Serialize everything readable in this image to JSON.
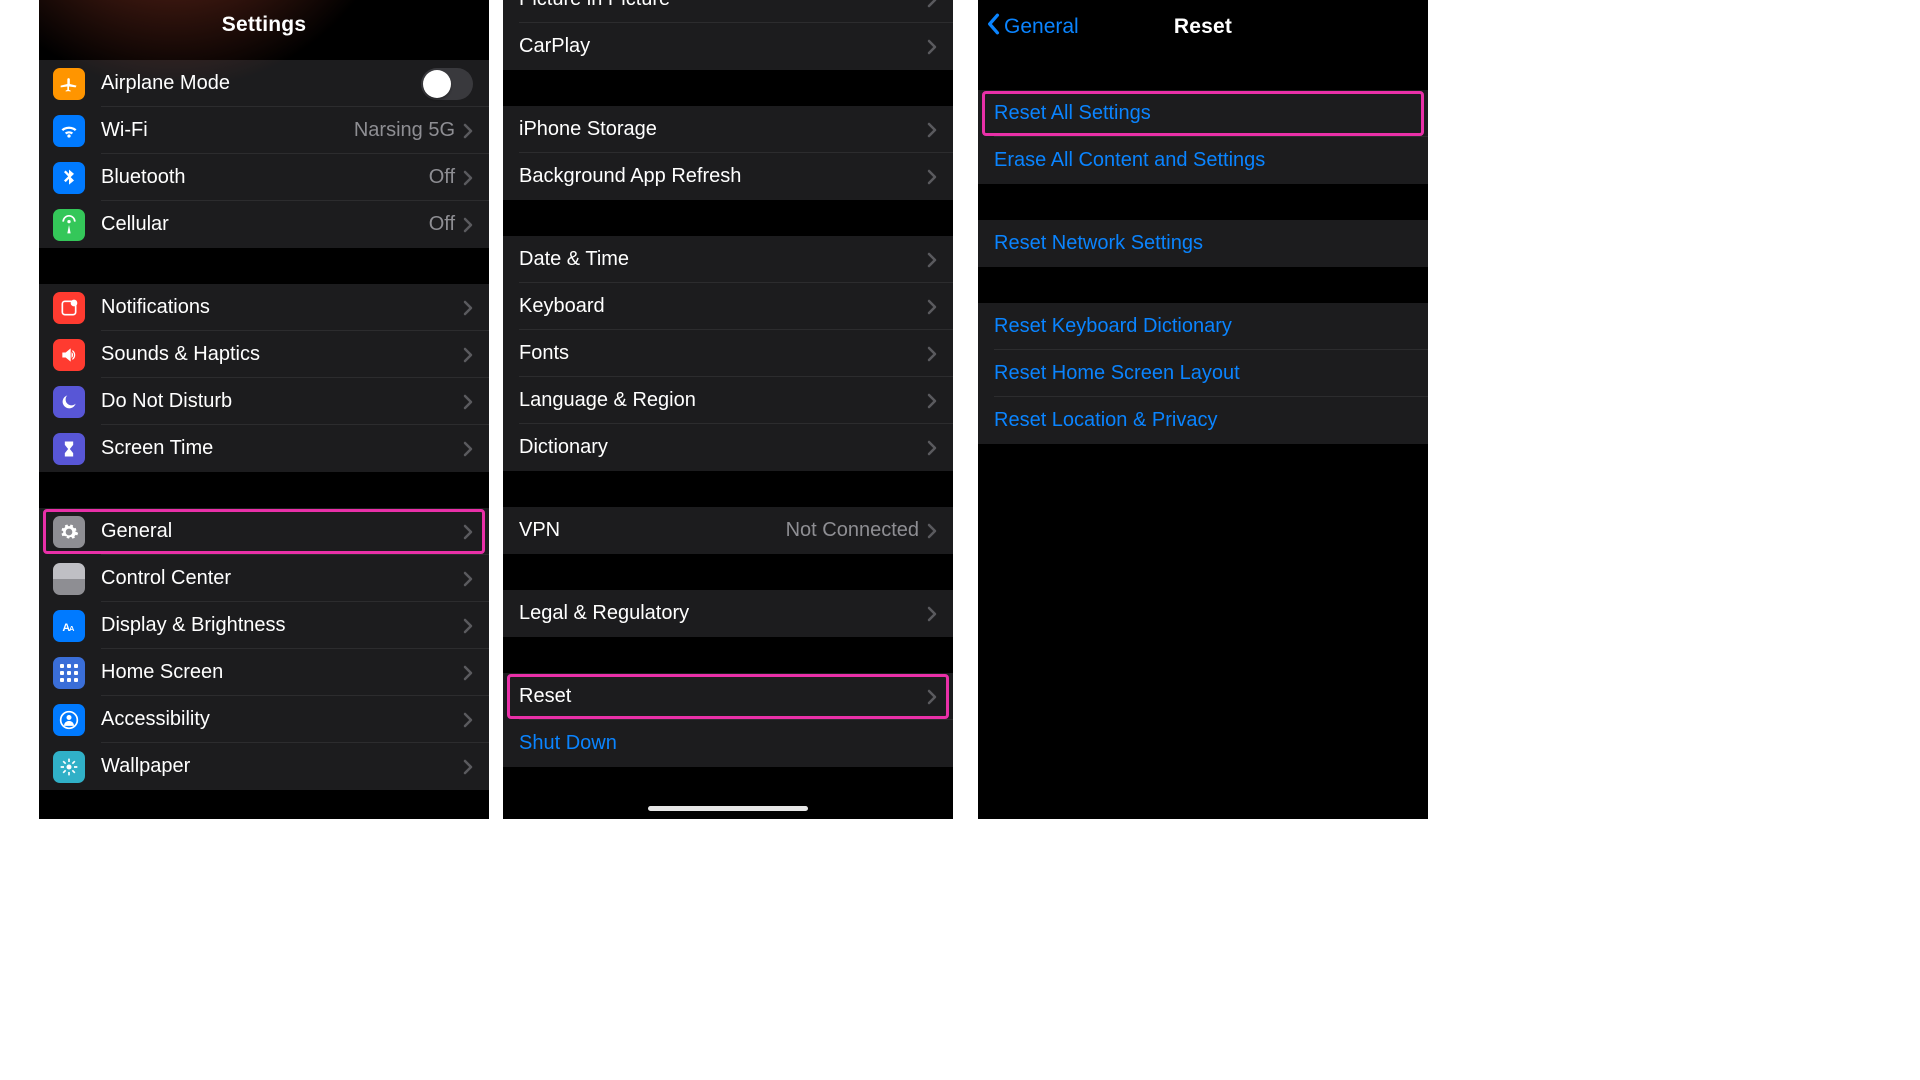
{
  "panel1": {
    "title": "Settings",
    "groups": [
      [
        {
          "name": "airplane",
          "label": "Airplane Mode",
          "type": "toggle",
          "on": false,
          "color": "bg-orange",
          "icon": "plane"
        },
        {
          "name": "wifi",
          "label": "Wi-Fi",
          "detail": "Narsing 5G",
          "color": "bg-blue",
          "icon": "wifi"
        },
        {
          "name": "bluetooth",
          "label": "Bluetooth",
          "detail": "Off",
          "color": "bg-blue",
          "icon": "bluetooth"
        },
        {
          "name": "cellular",
          "label": "Cellular",
          "detail": "Off",
          "color": "bg-green",
          "icon": "antenna"
        }
      ],
      [
        {
          "name": "notifications",
          "label": "Notifications",
          "color": "bg-red",
          "icon": "notif"
        },
        {
          "name": "sounds",
          "label": "Sounds & Haptics",
          "color": "bg-red",
          "icon": "speaker"
        },
        {
          "name": "dnd",
          "label": "Do Not Disturb",
          "color": "bg-purple",
          "icon": "moon"
        },
        {
          "name": "screentime",
          "label": "Screen Time",
          "color": "bg-purple",
          "icon": "hourglass"
        }
      ],
      [
        {
          "name": "general",
          "label": "General",
          "color": "bg-gray",
          "icon": "gear",
          "highlight": true
        },
        {
          "name": "control-center",
          "label": "Control Center",
          "icon": "stack"
        },
        {
          "name": "display",
          "label": "Display & Brightness",
          "color": "bg-blue",
          "icon": "aa"
        },
        {
          "name": "homescreen",
          "label": "Home Screen",
          "color": "bg-indigo",
          "icon": "grid"
        },
        {
          "name": "accessibility",
          "label": "Accessibility",
          "color": "bg-blue",
          "icon": "person"
        },
        {
          "name": "wallpaper",
          "label": "Wallpaper",
          "color": "bg-teal",
          "icon": "flower"
        }
      ]
    ]
  },
  "panel2": {
    "groups": [
      [
        {
          "name": "pip",
          "label": "Picture in Picture",
          "partial": true
        },
        {
          "name": "carplay",
          "label": "CarPlay"
        }
      ],
      [
        {
          "name": "storage",
          "label": "iPhone Storage"
        },
        {
          "name": "bg-refresh",
          "label": "Background App Refresh"
        }
      ],
      [
        {
          "name": "datetime",
          "label": "Date & Time"
        },
        {
          "name": "keyboard",
          "label": "Keyboard"
        },
        {
          "name": "fonts",
          "label": "Fonts"
        },
        {
          "name": "language",
          "label": "Language & Region"
        },
        {
          "name": "dictionary",
          "label": "Dictionary"
        }
      ],
      [
        {
          "name": "vpn",
          "label": "VPN",
          "detail": "Not Connected"
        }
      ],
      [
        {
          "name": "legal",
          "label": "Legal & Regulatory"
        }
      ],
      [
        {
          "name": "reset",
          "label": "Reset",
          "highlight": true
        },
        {
          "name": "shutdown",
          "label": "Shut Down",
          "link": true,
          "nochev": true
        }
      ]
    ]
  },
  "panel3": {
    "back": "General",
    "title": "Reset",
    "groups": [
      [
        {
          "name": "reset-all",
          "label": "Reset All Settings",
          "link": true,
          "nochev": true,
          "highlight": true
        },
        {
          "name": "erase-all",
          "label": "Erase All Content and Settings",
          "link": true,
          "nochev": true
        }
      ],
      [
        {
          "name": "reset-network",
          "label": "Reset Network Settings",
          "link": true,
          "nochev": true
        }
      ],
      [
        {
          "name": "reset-keyboard",
          "label": "Reset Keyboard Dictionary",
          "link": true,
          "nochev": true
        },
        {
          "name": "reset-home",
          "label": "Reset Home Screen Layout",
          "link": true,
          "nochev": true
        },
        {
          "name": "reset-location",
          "label": "Reset Location & Privacy",
          "link": true,
          "nochev": true
        }
      ]
    ]
  }
}
